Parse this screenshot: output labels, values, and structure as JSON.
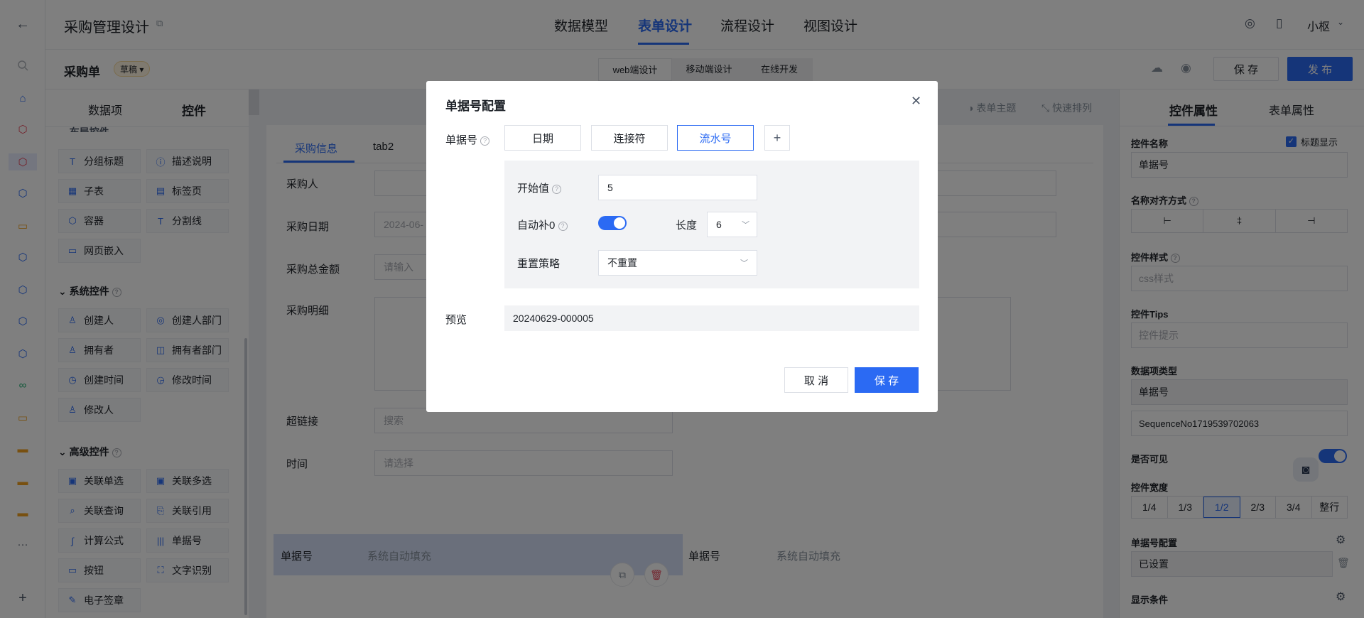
{
  "app": {
    "title": "采购管理设计",
    "user": "小枢"
  },
  "nav": {
    "tabs": [
      "数据模型",
      "表单设计",
      "流程设计",
      "视图设计"
    ],
    "active": "表单设计"
  },
  "subbar": {
    "form_name": "采购单",
    "status_badge": "草稿",
    "segments": [
      "web端设计",
      "移动端设计",
      "在线开发"
    ],
    "save_label": "保 存",
    "publish_label": "发 布"
  },
  "palette": {
    "tabs": [
      "数据项",
      "控件"
    ],
    "section_cut": "布局控件",
    "layout_items": [
      "分组标题",
      "描述说明",
      "子表",
      "标签页",
      "容器",
      "分割线",
      "网页嵌入"
    ],
    "system_title": "系统控件",
    "system_items": [
      "创建人",
      "创建人部门",
      "拥有者",
      "拥有者部门",
      "创建时间",
      "修改时间",
      "修改人"
    ],
    "advanced_title": "高级控件",
    "advanced_items": [
      "关联单选",
      "关联多选",
      "关联查询",
      "关联引用",
      "计算公式",
      "单据号",
      "按钮",
      "文字识别",
      "电子签章"
    ]
  },
  "canvas": {
    "toolbar": [
      "表单主题",
      "快速排列"
    ],
    "tabs": [
      "采购信息",
      "tab2"
    ],
    "fields": {
      "buyer": "采购人",
      "date": "采购日期",
      "date_placeholder": "2024-06-",
      "amount": "采购总金额",
      "amount_placeholder": "请输入",
      "detail": "采购明细",
      "link": "超链接",
      "link_placeholder": "搜索",
      "time": "时间",
      "time_placeholder": "请选择",
      "docno": "单据号",
      "docno_value": "系统自动填充"
    }
  },
  "props": {
    "tabs": [
      "控件属性",
      "表单属性"
    ],
    "name_label": "控件名称",
    "show_title_label": "标题显示",
    "name_value": "单据号",
    "align_label": "名称对齐方式",
    "style_label": "控件样式",
    "style_placeholder": "css样式",
    "tips_label": "控件Tips",
    "tips_placeholder": "控件提示",
    "type_label": "数据项类型",
    "type_value": "单据号",
    "code_value": "SequenceNo1719539702063",
    "visible_label": "是否可见",
    "width_label": "控件宽度",
    "widths": [
      "1/4",
      "1/3",
      "1/2",
      "2/3",
      "3/4",
      "整行"
    ],
    "docno_config_label": "单据号配置",
    "docno_config_value": "已设置",
    "cond_label": "显示条件"
  },
  "modal": {
    "title": "单据号配置",
    "docno_label": "单据号",
    "parts": [
      "日期",
      "连接符",
      "流水号"
    ],
    "add": "+",
    "start_label": "开始值",
    "start_value": "5",
    "autopad_label": "自动补0",
    "length_label": "长度",
    "length_value": "6",
    "reset_label": "重置策略",
    "reset_value": "不重置",
    "preview_label": "预览",
    "preview_value": "20240629-000005",
    "cancel": "取 消",
    "save": "保 存"
  },
  "colors": {
    "accent": "#2b6af3",
    "overlay": "rgba(0,0,0,0.5)"
  }
}
